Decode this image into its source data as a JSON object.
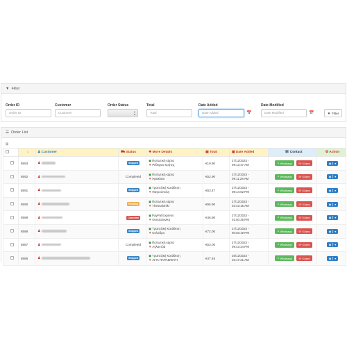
{
  "filter": {
    "title": "Filter",
    "fields": [
      {
        "label": "Order ID",
        "placeholder": "Order ID"
      },
      {
        "label": "Customer",
        "placeholder": "Customer"
      },
      {
        "label": "Order Status"
      },
      {
        "label": "Total",
        "placeholder": "Total"
      },
      {
        "label": "Date Added",
        "placeholder": "Date Added"
      },
      {
        "label": "Date Modified",
        "placeholder": "Date Modified"
      }
    ],
    "button_label": "Filter"
  },
  "order_list": {
    "title": "Order List",
    "columns": {
      "id": "",
      "customer": "Customer",
      "status": "Status",
      "details": "More Details",
      "total": "Total",
      "date": "Date Added",
      "contact": "Contact",
      "action": "Action"
    },
    "whatsapp_label": "Whatsapp",
    "call_label": "Κλήση",
    "rows": [
      {
        "id": "8593",
        "status": "Shipped",
        "status_color": "#3a87c8",
        "payment": "Πιστωτική κάρτα",
        "location": "Ρέθυμνο Κρήτης",
        "total": "€19.90",
        "date": "27/12/2023 -",
        "time": "09:13:47 AM"
      },
      {
        "id": "8592",
        "status": "Completed",
        "status_color": "",
        "payment": "Πιστωτική κάρτα",
        "location": "Ηρακλειο",
        "total": "€52.90",
        "date": "27/12/2023 -",
        "time": "09:11:28 AM"
      },
      {
        "id": "8591",
        "status": "Shipped",
        "status_color": "#3a87c8",
        "payment": "Τραπεζική Κατάθεση",
        "location": "Πατρούπολη",
        "total": "€63.47",
        "date": "27/12/2023 -",
        "time": "09:14:52 PM"
      },
      {
        "id": "8590",
        "status": "Pending",
        "status_color": "#f0ad4e",
        "payment": "Πιστωτική κάρτα",
        "location": "Thessaloniki",
        "total": "€66.90",
        "date": "27/12/2023 -",
        "time": "02:43:15 AM"
      },
      {
        "id": "8589",
        "status": "Canceled",
        "status_color": "#d9534f",
        "payment": "PayPal Express",
        "location": "Θεσσαλονίκη",
        "total": "€46.90",
        "date": "27/12/2023 -",
        "time": "01:50:35 PM"
      },
      {
        "id": "8588",
        "status": "Shipped",
        "status_color": "#3a87c8",
        "payment": "Τραπεζική Κατάθεση",
        "location": "Κολινδρο",
        "total": "€72.00",
        "date": "27/12/2023 -",
        "time": "00:03:19 PM"
      },
      {
        "id": "8587",
        "status": "Completed",
        "status_color": "",
        "payment": "Πιστωτική κάρτα",
        "location": "Αγλαντζιά",
        "total": "€53.00",
        "date": "27/12/2023 -",
        "time": "09:43:34 PM"
      },
      {
        "id": "8586",
        "status": "Shipped",
        "status_color": "#3a87c8",
        "payment": "Τραπεζική Κατάθεση",
        "location": "ΑΓΙΑ ΠΑΡΑΣΚΕΥΗ",
        "total": "€47.46",
        "date": "26/12/2023 -",
        "time": "10:17:21 AM"
      }
    ]
  }
}
